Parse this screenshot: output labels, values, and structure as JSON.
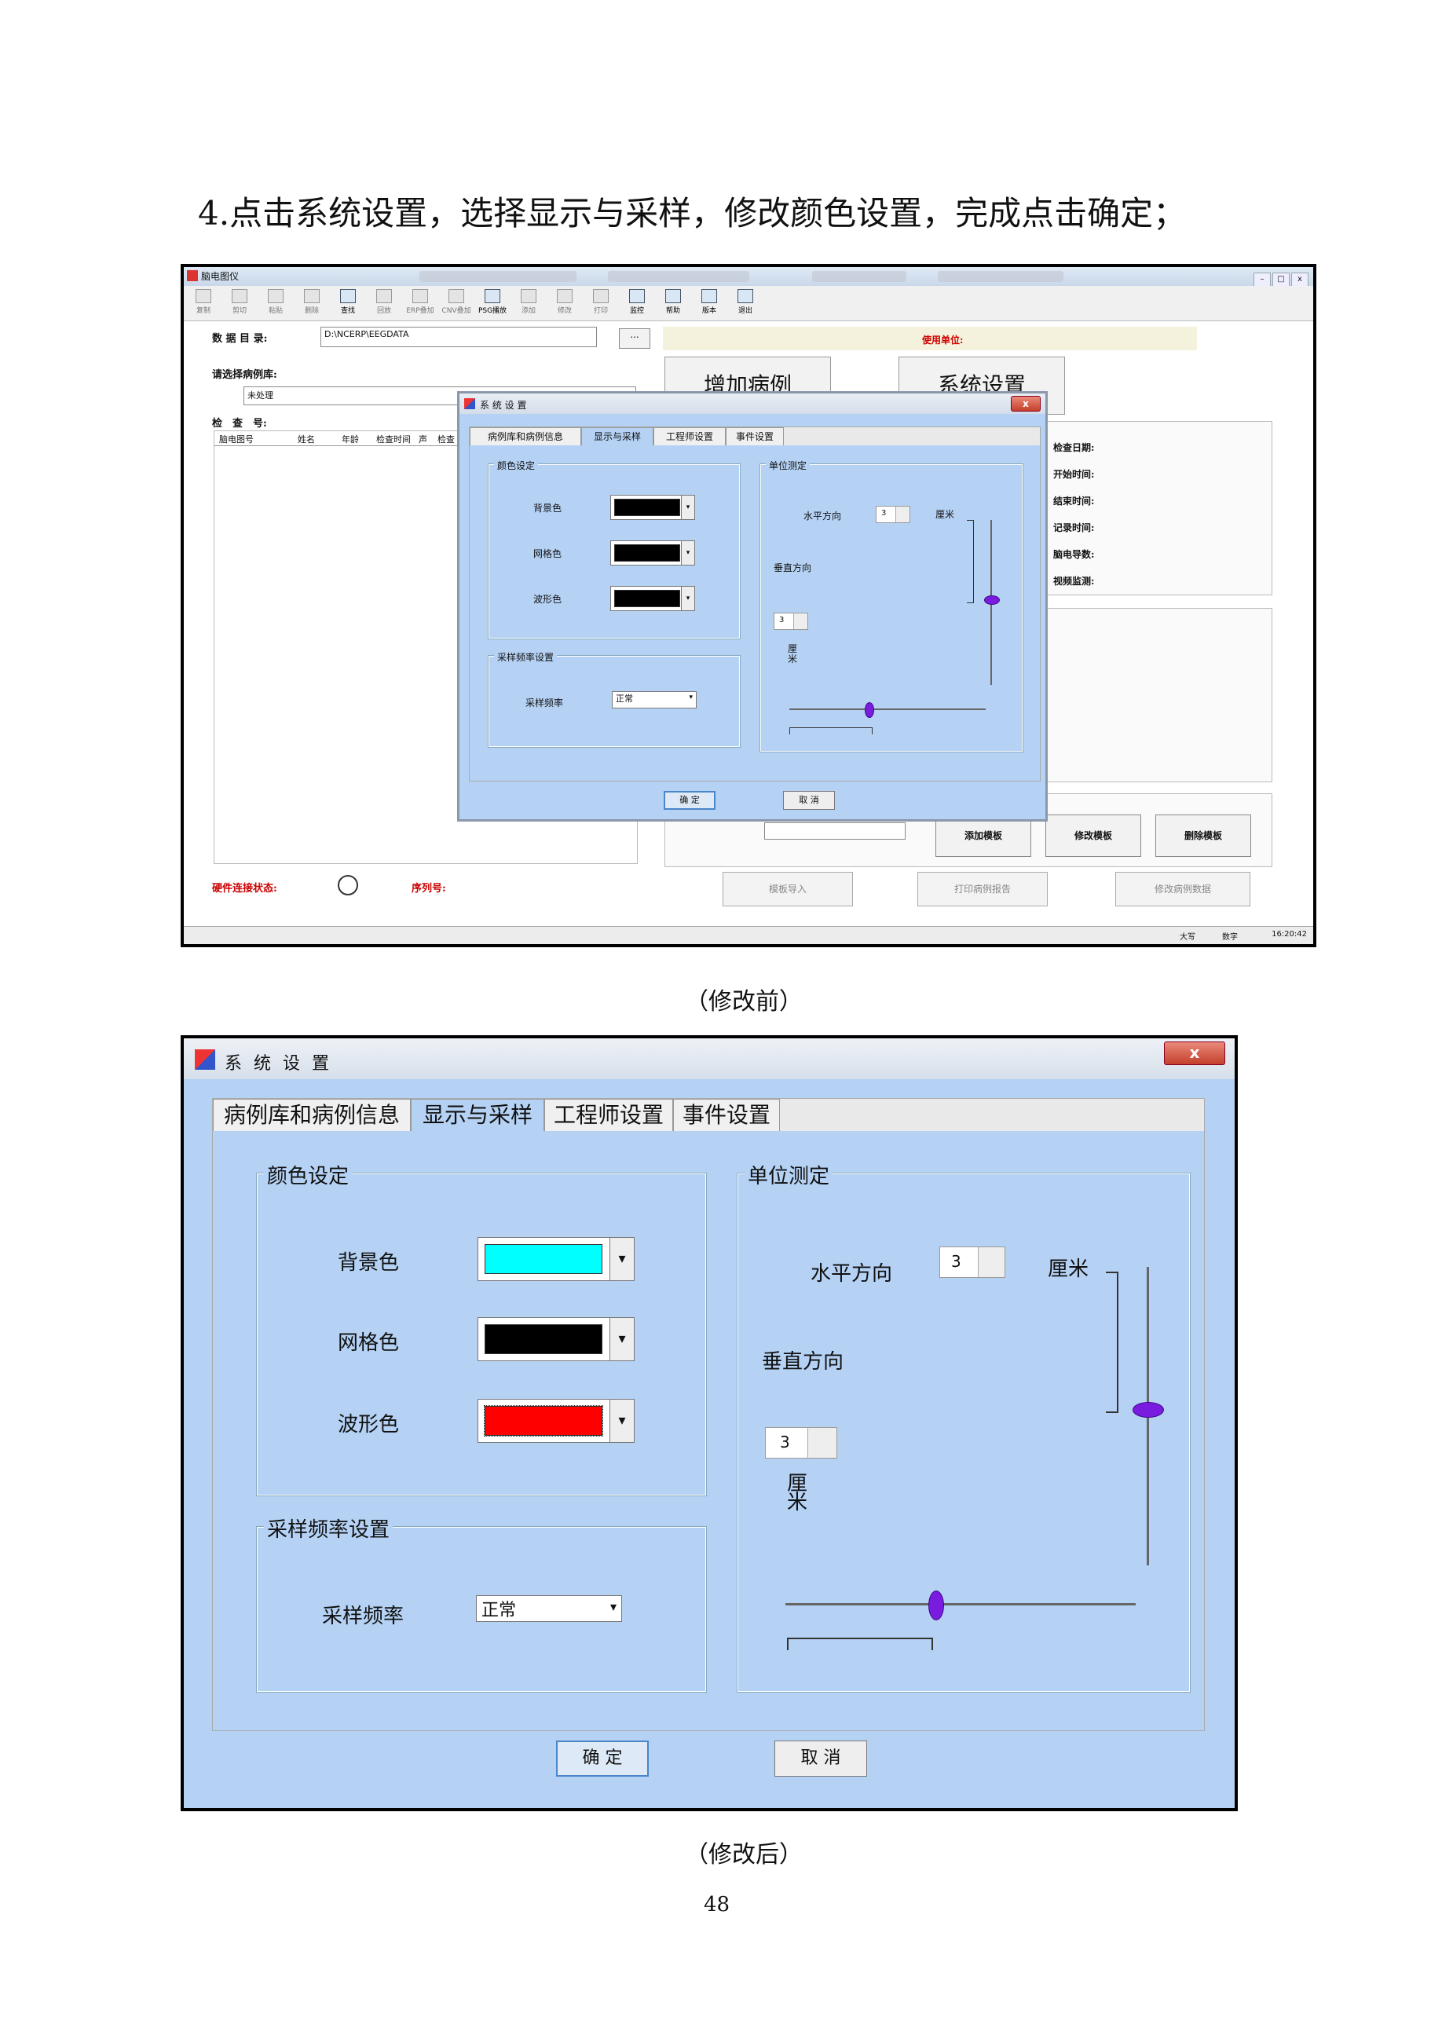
{
  "heading": "4.点击系统设置，选择显示与采样，修改颜色设置，完成点击确定；",
  "caption_before": "（修改前）",
  "caption_after": "（修改后）",
  "page_number": "48",
  "main_window": {
    "title": "脑电图仪",
    "toolbar": [
      "复制",
      "剪切",
      "粘贴",
      "删除",
      "查找",
      "回放",
      "ERP叠加",
      "CNV叠加",
      "PSG播放",
      "添加",
      "修改",
      "打印",
      "监控",
      "帮助",
      "版本",
      "退出"
    ],
    "data_dir_label": "数 据 目 录:",
    "data_dir_value": "D:\\NCERP\\EEGDATA",
    "browse_label": "...",
    "choose_db_label": "请选择病例库:",
    "db_value": "未处理",
    "exam_no_label": "检　查　号:",
    "grid_columns": [
      "脑电图号",
      "姓名",
      "年龄",
      "检查时间",
      "声",
      "检查"
    ],
    "use_unit_label": "使用单位:",
    "add_case_button": "增加病例",
    "system_settings_button": "系统设置",
    "info_labels": [
      "检查日期:",
      "开始时间:",
      "结束时间:",
      "记录时间:",
      "脑电导数:",
      "视频监测:"
    ],
    "add_template": "添加模板",
    "edit_template": "修改模板",
    "delete_template": "删除模板",
    "template_import": "模板导入",
    "print_report": "打印病例报告",
    "edit_case_data": "修改病例数据",
    "hw_status_label": "硬件连接状态:",
    "serial_label": "序列号:",
    "status_items": [
      "大写",
      "数字",
      "16:20:42"
    ]
  },
  "dialog": {
    "title": "系 统 设 置",
    "close": "x",
    "tabs": [
      "病例库和病例信息",
      "显示与采样",
      "工程师设置",
      "事件设置"
    ],
    "color_group": "颜色设定",
    "bg_label": "背景色",
    "grid_label": "网格色",
    "wave_label": "波形色",
    "rate_group": "采样频率设置",
    "rate_label": "采样频率",
    "rate_value": "正常",
    "unit_group": "单位测定",
    "horizontal_label": "水平方向",
    "horizontal_value": "3",
    "cm_label_h": "厘米",
    "vertical_label": "垂直方向",
    "vertical_value": "3",
    "cm_label_v": "厘米",
    "ok": "确 定",
    "cancel": "取 消",
    "before_colors": {
      "background": "#000000",
      "grid": "#000000",
      "waveform": "#000000"
    },
    "after_colors": {
      "background": "#00ffff",
      "grid": "#000000",
      "waveform": "#ff0000"
    }
  }
}
